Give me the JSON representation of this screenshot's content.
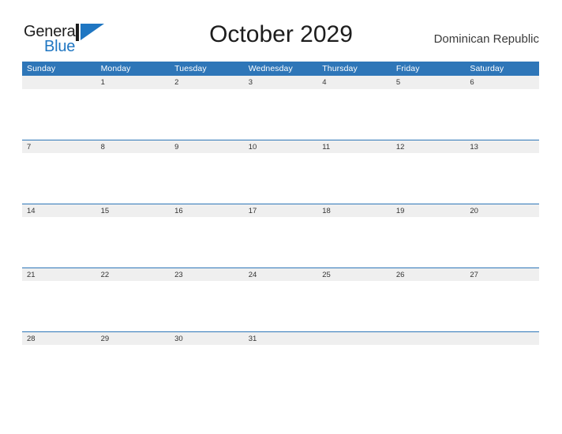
{
  "brand": {
    "name_part1": "General",
    "name_part2": "Blue",
    "flag_icon": "blue-triangle-flag-icon",
    "color_dark": "#1d1d1d",
    "color_blue": "#1f76c2"
  },
  "header": {
    "title": "October 2029",
    "country": "Dominican Republic"
  },
  "theme": {
    "header_blue": "#2e76b8",
    "band_gray": "#efefef",
    "text_dark": "#333333",
    "page_bg": "#ffffff"
  },
  "calendar": {
    "month": "October",
    "year": "2029",
    "weekday_headers": [
      "Sunday",
      "Monday",
      "Tuesday",
      "Wednesday",
      "Thursday",
      "Friday",
      "Saturday"
    ],
    "weeks": [
      {
        "days": [
          "",
          "1",
          "2",
          "3",
          "4",
          "5",
          "6"
        ]
      },
      {
        "days": [
          "7",
          "8",
          "9",
          "10",
          "11",
          "12",
          "13"
        ]
      },
      {
        "days": [
          "14",
          "15",
          "16",
          "17",
          "18",
          "19",
          "20"
        ]
      },
      {
        "days": [
          "21",
          "22",
          "23",
          "24",
          "25",
          "26",
          "27"
        ]
      },
      {
        "days": [
          "28",
          "29",
          "30",
          "31",
          "",
          "",
          ""
        ]
      }
    ]
  }
}
